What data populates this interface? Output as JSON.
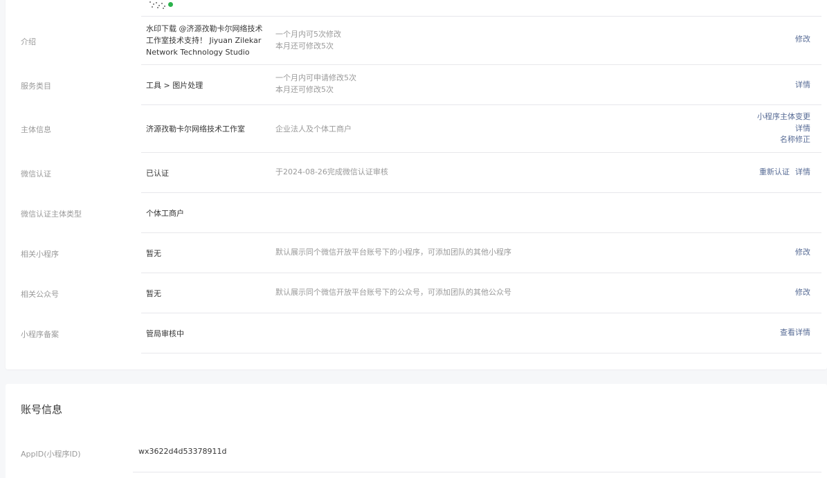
{
  "basic_info": {
    "rows": [
      {
        "label": "介绍",
        "value": "水印下载 @济源孜勒卡尔网络技术工作室技术支持！ Jiyuan Zilekar Network Technology Studio",
        "desc": [
          "一个月内可5次修改",
          "本月还可修改5次"
        ],
        "actions": [
          "修改"
        ]
      },
      {
        "label": "服务类目",
        "value": "工具 > 图片处理",
        "desc": [
          "一个月内可申请修改5次",
          "本月还可修改5次"
        ],
        "actions": [
          "详情"
        ]
      },
      {
        "label": "主体信息",
        "value": "济源孜勒卡尔网络技术工作室",
        "desc": [
          "企业法人及个体工商户"
        ],
        "actions": [
          "小程序主体变更",
          "详情",
          "名称修正"
        ]
      },
      {
        "label": "微信认证",
        "value": "已认证",
        "desc": [
          "于2024-08-26完成微信认证审核"
        ],
        "actions": [
          "重新认证",
          "详情"
        ]
      },
      {
        "label": "微信认证主体类型",
        "value": "个体工商户",
        "desc": [],
        "actions": []
      },
      {
        "label": "相关小程序",
        "value": "暂无",
        "desc": [
          "默认展示同个微信开放平台账号下的小程序，可添加团队的其他小程序"
        ],
        "actions": [
          "修改"
        ]
      },
      {
        "label": "相关公众号",
        "value": "暂无",
        "desc": [
          "默认展示同个微信开放平台账号下的公众号，可添加团队的其他公众号"
        ],
        "actions": [
          "修改"
        ]
      },
      {
        "label": "小程序备案",
        "value": "管局审核中",
        "desc": [],
        "actions": [
          "查看详情"
        ]
      }
    ]
  },
  "account_info": {
    "title": "账号信息",
    "appid_label": "AppID(小程序ID)",
    "appid_value": "wx3622d4d53378911d"
  },
  "colors": {
    "link": "#576b95",
    "muted": "#9a9a9a",
    "text": "#353535",
    "divider": "#e7e7eb",
    "qr_accent": "#2bb24c"
  }
}
